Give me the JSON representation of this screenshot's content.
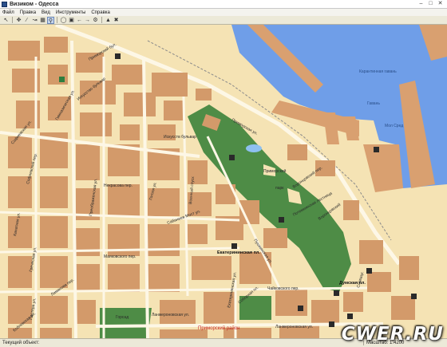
{
  "window": {
    "title": "Визиком - Одесса",
    "controls": [
      "minimize-icon",
      "maximize-icon",
      "close-icon"
    ]
  },
  "menu": {
    "items": [
      "Файл",
      "Правка",
      "Вид",
      "Инструменты",
      "Справка"
    ]
  },
  "toolbar": {
    "tools": [
      "pointer-icon",
      "pan-icon",
      "measure-icon",
      "route-icon",
      "grid-icon",
      "zoom-in-icon",
      "zoom-out-icon",
      "zoom-fit-icon",
      "back-icon",
      "forward-icon",
      "settings-icon",
      "object-icon",
      "delete-icon"
    ]
  },
  "map": {
    "colors": {
      "land": "#f5e3b4",
      "building": "#d39a6a",
      "park": "#4e8c46",
      "water": "#6f9ee8",
      "road": "#fdf7e6",
      "pier": "#d9a070"
    },
    "labels": {
      "sea": "Карантинная гавань",
      "harbor": "Гавань",
      "harbor2": "Мол Сред",
      "iskusstv": "Искусство бульвар",
      "iskusstv2": "Искусств бульвар",
      "primorskiy": "Приморский бул.",
      "potemkin": "Потемкинская лестница",
      "prim_park": "Приморский",
      "prim_park2": "парк",
      "sabaneev": "Сабанеев Мост ул.",
      "ekaterininskaya_pl": "Екатерининская пл.",
      "pushkinskaya": "Пушкинская ул.",
      "preobr": "Преображенская ул.",
      "nekrasova": "Некрасова пер.",
      "mayakovsky": "Маяковского пер.",
      "lanzheronovskaya": "Ланжероновская ул.",
      "lanzheronovskaya2": "Ланжероновская ул.",
      "ekaterininskaya": "Екатерининская ул.",
      "chaikovskogo": "Чайковского пер.",
      "district": "Приморский район",
      "dumskaya": "Думская пл.",
      "vorontsov": "Воронцовский пер.",
      "gogol": "Гоголя ул.",
      "voennyi": "Военный спуск",
      "sofievskaya": "Софиевская ул.",
      "kanatnaya": "Канатная ул.",
      "gretskaya": "Греческая ул.",
      "pastera": "Пастера ул.",
      "koblevskaya": "Коблевская ул.",
      "gimnazich": "Гимназическая ул.",
      "primorskaya": "Приморская ул.",
      "sobornaya": "Соборная пл.",
      "gorsad": "Горсад",
      "lomonosova": "Ламанова пер.",
      "sofievskiy": "Софиевский пер.",
      "slovaka": "Словацк.",
      "vorontsov2": "Воронцовский"
    }
  },
  "status": {
    "current_object_label": "Текущий объект:",
    "scale_label": "Масштаб: 1:4200"
  },
  "watermark": "CWER.RU"
}
